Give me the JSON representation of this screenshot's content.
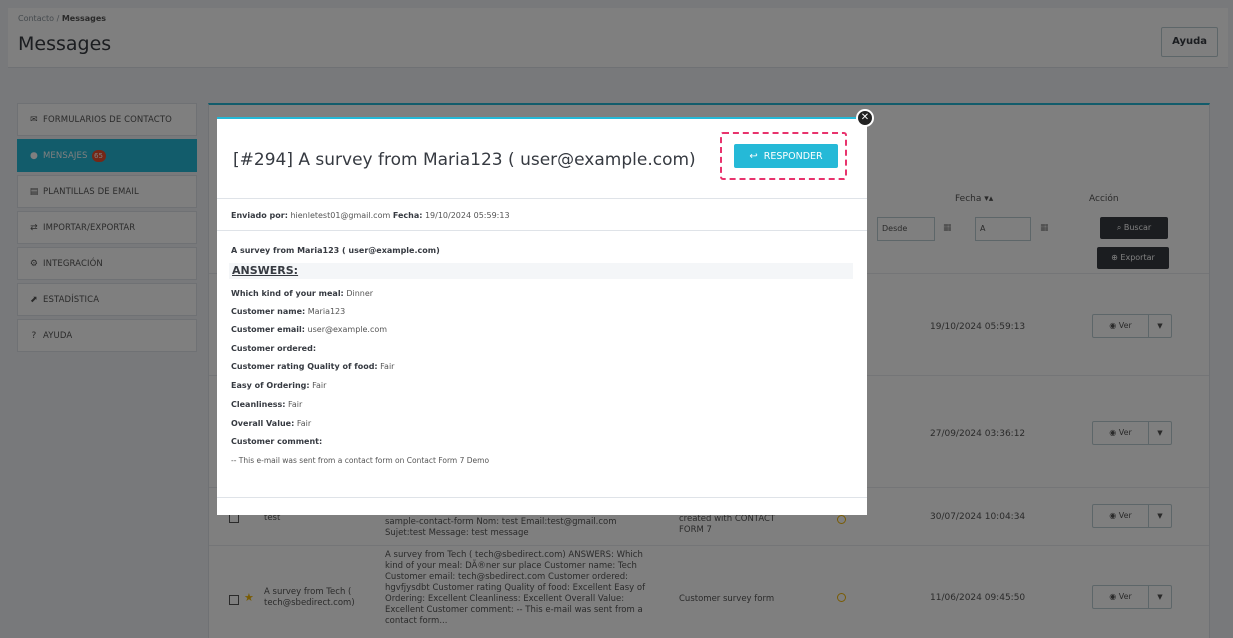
{
  "breadcrumb": {
    "parent": "Contacto",
    "separator": "/",
    "current": "Messages"
  },
  "page": {
    "title": "Messages",
    "help_label": "Ayuda"
  },
  "sidebar": {
    "items": [
      {
        "label": "FORMULARIOS DE CONTACTO",
        "icon": "envelope-icon"
      },
      {
        "label": "MENSAJES",
        "icon": "comments-icon",
        "badge": "65"
      },
      {
        "label": "PLANTILLAS DE EMAIL",
        "icon": "file-icon"
      },
      {
        "label": "IMPORTAR/EXPORTAR",
        "icon": "exchange-icon"
      },
      {
        "label": "INTEGRACIÓN",
        "icon": "cogs-icon"
      },
      {
        "label": "ESTADÍSTICA",
        "icon": "chart-icon"
      },
      {
        "label": "AYUDA",
        "icon": "question-icon"
      }
    ]
  },
  "table": {
    "col_fecha": "Fecha",
    "col_accion": "Acción",
    "filter_desde": "Desde",
    "filter_a": "A",
    "search_label": "Buscar",
    "export_label": "Exportar",
    "view_label": "Ver",
    "rows": [
      {
        "date": "19/10/2024 05:59:13"
      },
      {
        "date": "27/09/2024 03:36:12"
      },
      {
        "date": "30/07/2024 10:04:34",
        "subject": "test",
        "message_lines": [
          "sample-contact-form Nom: test Email:test@gmail.com",
          "Sujet:test Message: test message"
        ],
        "form_lines": [
          "created with CONTACT",
          "FORM 7"
        ]
      },
      {
        "date": "11/06/2024 09:45:50",
        "subject_lines": [
          "A survey from Tech (",
          "tech@sbedirect.com)"
        ],
        "message_lines": [
          "A survey from Tech ( tech@sbedirect.com) ANSWERS: Which",
          "kind of your meal: DÃ®ner sur place Customer name: Tech",
          "Customer email: tech@sbedirect.com Customer ordered:",
          "hgvfjysdbt Customer rating Quality of food: Excellent Easy of",
          "Ordering: Excellent Cleanliness: Excellent Overall Value:",
          "Excellent Customer comment: -- This e-mail was sent from a",
          "contact form..."
        ],
        "form": "Customer survey form"
      }
    ]
  },
  "modal": {
    "title": "[#294] A survey from Maria123 ( user@example.com)",
    "reply_label": "RESPONDER",
    "sent_by_label": "Enviado por:",
    "sent_by_value": "hienletest01@gmail.com",
    "date_label": "Fecha:",
    "date_value": "19/10/2024 05:59:13",
    "body_title": "A survey from Maria123 ( user@example.com)",
    "answers_heading": "ANSWERS:",
    "fields": [
      {
        "label": "Which kind of your meal:",
        "value": "Dinner"
      },
      {
        "label": "Customer name:",
        "value": "Maria123"
      },
      {
        "label": "Customer email:",
        "value": "user@example.com"
      },
      {
        "label": "Customer ordered:",
        "value": ""
      },
      {
        "label": "Customer rating Quality of food:",
        "value": "Fair"
      },
      {
        "label": "Easy of Ordering:",
        "value": "Fair"
      },
      {
        "label": "Cleanliness:",
        "value": "Fair"
      },
      {
        "label": "Overall Value:",
        "value": "Fair"
      },
      {
        "label": "Customer comment:",
        "value": ""
      }
    ],
    "footer_note": "-- This e-mail was sent from a contact form on Contact Form 7 Demo"
  },
  "colors": {
    "accent": "#25b9d7",
    "highlight": "#e8336d",
    "badge": "#e84e2e",
    "dark": "#363a41"
  }
}
